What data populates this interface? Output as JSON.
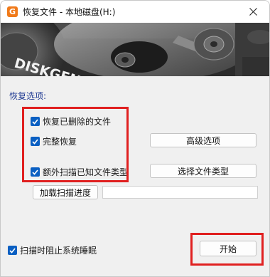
{
  "window": {
    "title": "恢复文件 - 本地磁盘(H:)",
    "app_icon_letter": "G",
    "close_glyph": "✕"
  },
  "banner": {
    "brand_text": "DISKGENIUS"
  },
  "options": {
    "section_label": "恢复选项:",
    "recover_deleted": {
      "label": "恢复已删除的文件",
      "checked": true
    },
    "complete_recovery": {
      "label": "完整恢复",
      "checked": true
    },
    "extra_scan": {
      "label": "额外扫描已知文件类型",
      "checked": true
    },
    "advanced_button": "高级选项",
    "select_types_button": "选择文件类型",
    "load_progress_button": "加载扫描进度",
    "scan_progress": 0
  },
  "footer": {
    "prevent_sleep": {
      "label": "扫描时阻止系统睡眠",
      "checked": true
    },
    "start_button": "开始"
  },
  "colors": {
    "accent": "#0a5fc2",
    "highlight": "#e02020",
    "section_label": "#1f3a93",
    "app_icon": "#f07a1a"
  }
}
